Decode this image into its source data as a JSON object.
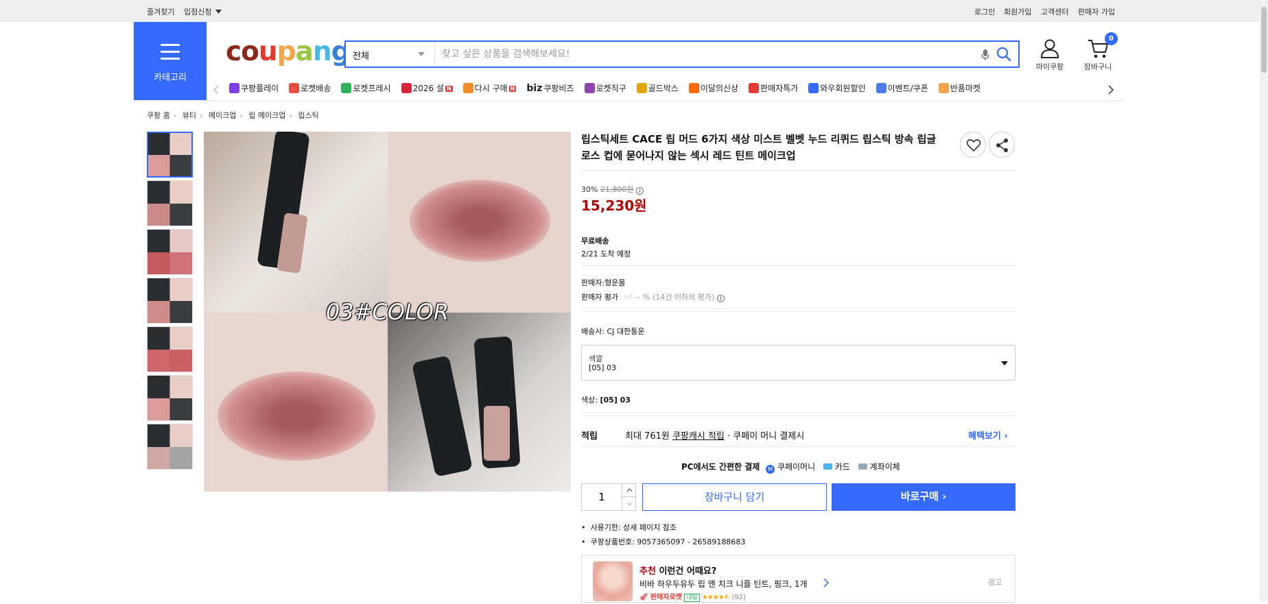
{
  "topbar": {
    "left": [
      "즐겨찾기",
      "입점신청"
    ],
    "right": [
      "로그인",
      "회원가입",
      "고객센터",
      "판매자 가입"
    ]
  },
  "header": {
    "category_label": "카테고리",
    "logo": "coupang",
    "search_category": "전체",
    "search_placeholder": "찾고 싶은 상품을 검색해보세요!",
    "mycoupang": "마이쿠팡",
    "cart": "장바구니",
    "cart_count": "0"
  },
  "nav": [
    {
      "label": "쿠팡플레이",
      "color": "#7b3fe4"
    },
    {
      "label": "로켓배송",
      "color": "#e84f3f"
    },
    {
      "label": "로켓프레시",
      "color": "#2fb35b"
    },
    {
      "label": "2026 설",
      "color": "#d7263d",
      "badge": "N"
    },
    {
      "label": "다시 구매",
      "color": "#f28c28",
      "badge": "N"
    },
    {
      "label": "쿠팡비즈",
      "color": "#222222",
      "prefix": "biz"
    },
    {
      "label": "로켓직구",
      "color": "#8e44ad"
    },
    {
      "label": "골드박스",
      "color": "#e0a800"
    },
    {
      "label": "이달의신상",
      "color": "#ff6a00"
    },
    {
      "label": "판매자특가",
      "color": "#e53935"
    },
    {
      "label": "와우회원할인",
      "color": "#346aff"
    },
    {
      "label": "이벤트/쿠폰",
      "color": "#4b7bec"
    },
    {
      "label": "반품마켓",
      "color": "#f2a54a"
    }
  ],
  "breadcrumb": [
    "쿠팡 홈",
    "뷰티",
    "메이크업",
    "립 메이크업",
    "립스틱"
  ],
  "image_text": "03#COLOR",
  "product": {
    "title": "립스틱세트 CACE 립 머드 6가지 색상 미스트 벨벳 누드 리퀴드 립스틱 방속 립글로스 컵에 묻어나지 않는 섹시 레드 틴트 메이크업",
    "discount": "30%",
    "original_price": "21,800원",
    "price": "15,230원",
    "shipping_title": "무료배송",
    "arrival": "2/21 도착 예정",
    "seller": "판매자:형운몰",
    "seller_rating_label": "판매자 평가",
    "seller_rating_value": "-- % (14건 이하의 평가)",
    "carrier": "배송사:  CJ 대한통운",
    "option_label": "색깔",
    "option_value": "[05] 03",
    "color_line_label": "색상:",
    "color_line_value": "[05] 03",
    "reward_label": "적립",
    "reward_text_1": "최대 761원",
    "reward_text_2": "쿠팡캐시 적립",
    "reward_text_3": "· 쿠페이 머니 결제시",
    "benefit_link": "혜택보기",
    "pay_title": "PC에서도 간편한 결제",
    "pay_methods": [
      "쿠페이머니",
      "카드",
      "계좌이체"
    ],
    "quantity": "1",
    "cart_button": "장바구니 담기",
    "buy_button": "바로구매",
    "bullets": [
      "사용기한: 상세 페이지 참조",
      "쿠팡상품번호: 9057365097 - 26589188683"
    ]
  },
  "recommend": {
    "title_highlight": "추천",
    "title_rest": "이런건 어때요?",
    "item": "비바 하우두유두 립 앤 치크 니플 틴트, 핑크, 1개",
    "tag1": "판매자로켓",
    "tag2": "내일",
    "rating": 4.5,
    "review_count": "(92)",
    "ad": "광고"
  }
}
